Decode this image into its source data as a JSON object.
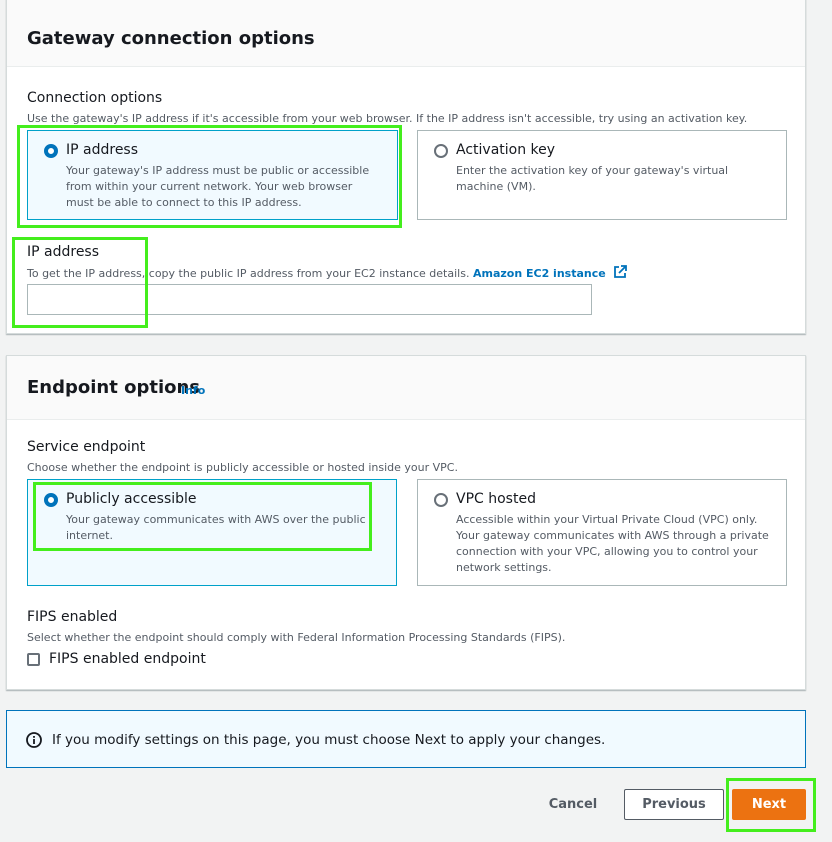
{
  "gateway_panel": {
    "title": "Gateway connection options",
    "connection_label": "Connection options",
    "connection_desc": "Use the gateway's IP address if it's accessible from your web browser. If the IP address isn't accessible, try using an activation key.",
    "options": [
      {
        "title": "IP address",
        "desc_lines": [
          "Your gateway's IP address must be public or accessible",
          "from within your current network. Your web browser",
          "must be able to connect to this IP address."
        ],
        "selected": true
      },
      {
        "title": "Activation key",
        "desc_lines": [
          "Enter the activation key of your gateway's virtual",
          "machine (VM)."
        ],
        "selected": false
      }
    ],
    "ip_label": "IP address",
    "ip_desc": "To get the IP address, copy the public IP address from your EC2 instance details.",
    "ip_link": "Amazon EC2 instance",
    "ip_value": ""
  },
  "endpoint_panel": {
    "title": "Endpoint options",
    "info": "Info",
    "service_label": "Service endpoint",
    "service_desc": "Choose whether the endpoint is publicly accessible or hosted inside your VPC.",
    "options": [
      {
        "title": "Publicly accessible",
        "desc_lines": [
          "Your gateway communicates with AWS over the public",
          "internet."
        ],
        "selected": true
      },
      {
        "title": "VPC hosted",
        "desc_lines": [
          "Accessible within your Virtual Private Cloud (VPC) only.",
          "Your gateway communicates with AWS through a private",
          "connection with your VPC, allowing you to control your",
          "network settings."
        ],
        "selected": false
      }
    ],
    "fips_label": "FIPS enabled",
    "fips_desc": "Select whether the endpoint should comply with Federal Information Processing Standards (FIPS).",
    "fips_checkbox_label": "FIPS enabled endpoint",
    "fips_checked": false
  },
  "alert": {
    "icon": "info-icon",
    "text": "If you modify settings on this page, you must choose Next to apply your changes."
  },
  "actions": {
    "cancel": "Cancel",
    "previous": "Previous",
    "next": "Next"
  },
  "colors": {
    "accent": "#0073bb",
    "primary_button": "#ec7211",
    "highlight": "#44ee1d"
  }
}
